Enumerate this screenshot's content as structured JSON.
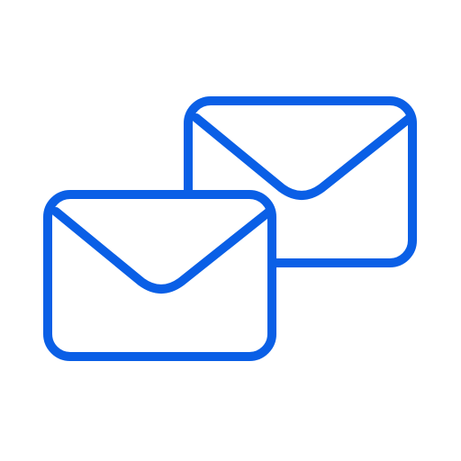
{
  "icon": {
    "name": "two-envelopes-icon",
    "stroke_color": "#0A5FE6",
    "background_color": "#FFFFFF"
  },
  "envelopes": [
    {
      "name": "envelope-icon-back"
    },
    {
      "name": "envelope-icon-front"
    }
  ]
}
